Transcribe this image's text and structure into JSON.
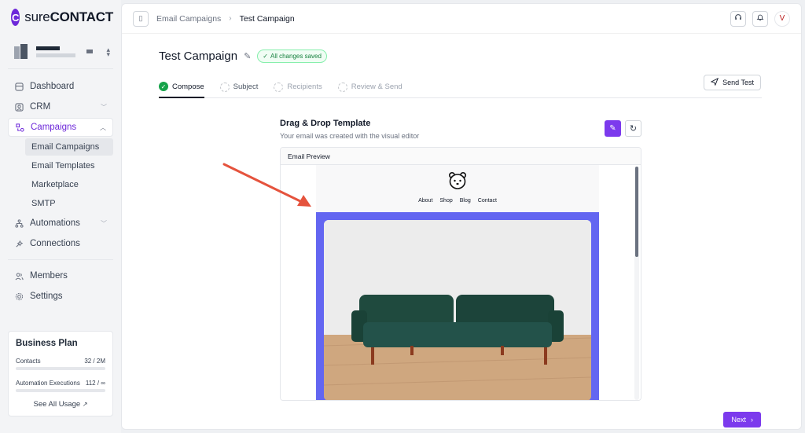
{
  "brand": {
    "logo_letter": "C",
    "name_prefix": "sure",
    "name_suffix": "CONTACT"
  },
  "sidebar": {
    "items": [
      {
        "label": "Dashboard",
        "icon": "dashboard-icon"
      },
      {
        "label": "CRM",
        "icon": "contacts-icon"
      },
      {
        "label": "Campaigns",
        "icon": "campaigns-icon"
      },
      {
        "label": "Automations",
        "icon": "automations-icon"
      },
      {
        "label": "Connections",
        "icon": "connections-icon"
      },
      {
        "label": "Members",
        "icon": "members-icon"
      },
      {
        "label": "Settings",
        "icon": "settings-icon"
      }
    ],
    "campaign_sub": [
      "Email Campaigns",
      "Email Templates",
      "Marketplace",
      "SMTP"
    ]
  },
  "plan": {
    "title": "Business Plan",
    "contacts_label": "Contacts",
    "contacts_value": "32 / 2M",
    "contacts_fraction": 0.0,
    "automation_label": "Automation Executions",
    "automation_value": "112 / ∞",
    "automation_fraction": 0.0,
    "see_all": "See All Usage"
  },
  "topbar": {
    "breadcrumb_parent": "Email Campaigns",
    "breadcrumb_current": "Test Campaign",
    "avatar_letter": "V"
  },
  "campaign": {
    "title": "Test Campaign",
    "saved_badge": "All changes saved",
    "steps": [
      "Compose",
      "Subject",
      "Recipients",
      "Review & Send"
    ],
    "send_test": "Send Test",
    "next": "Next"
  },
  "template": {
    "title": "Drag & Drop Template",
    "subtitle": "Your email was created with the visual editor",
    "preview_label": "Email Preview",
    "nav": [
      "About",
      "Shop",
      "Blog",
      "Contact"
    ]
  },
  "colors": {
    "accent": "#7c3aed",
    "hero": "#6366f1",
    "success": "#16a34a",
    "annotation": "#e5533d"
  }
}
